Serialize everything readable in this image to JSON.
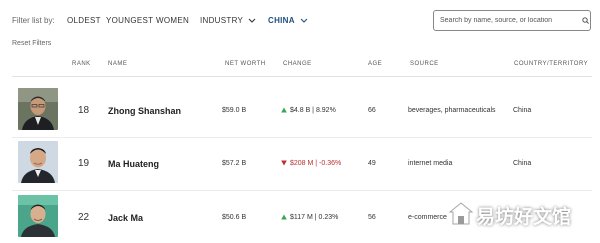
{
  "filters": {
    "label": "Filter list by:",
    "items": [
      "OLDEST",
      "YOUNGEST",
      "WOMEN",
      "INDUSTRY",
      "CHINA"
    ],
    "active": "CHINA",
    "accent": "#1f4f7f"
  },
  "search": {
    "placeholder": "Search by name, source, or location",
    "value": ""
  },
  "reset_label": "Reset Filters",
  "columns": {
    "rank": "RANK",
    "name": "NAME",
    "net_worth": "NET WORTH",
    "change": "CHANGE",
    "age": "AGE",
    "source": "SOURCE",
    "country": "COUNTRY/TERRITORY"
  },
  "rows": [
    {
      "rank": "18",
      "name": "Zhong Shanshan",
      "net_worth": "$59.0 B",
      "change": "$4.8 B | 8.92%",
      "direction": "up",
      "age": "66",
      "source": "beverages, pharmaceuticals",
      "country": "China"
    },
    {
      "rank": "19",
      "name": "Ma Huateng",
      "net_worth": "$57.2 B",
      "change": "$208 M | -0.36%",
      "direction": "down",
      "age": "49",
      "source": "internet media",
      "country": "China"
    },
    {
      "rank": "22",
      "name": "Jack Ma",
      "net_worth": "$50.6 B",
      "change": "$117 M | 0.23%",
      "direction": "up",
      "age": "56",
      "source": "e-commerce",
      "country": ""
    }
  ],
  "colors": {
    "up": "#3aa655",
    "down": "#b8312f"
  },
  "watermark": {
    "text": "易坊好文馆",
    "icon": "house-logo-icon"
  }
}
